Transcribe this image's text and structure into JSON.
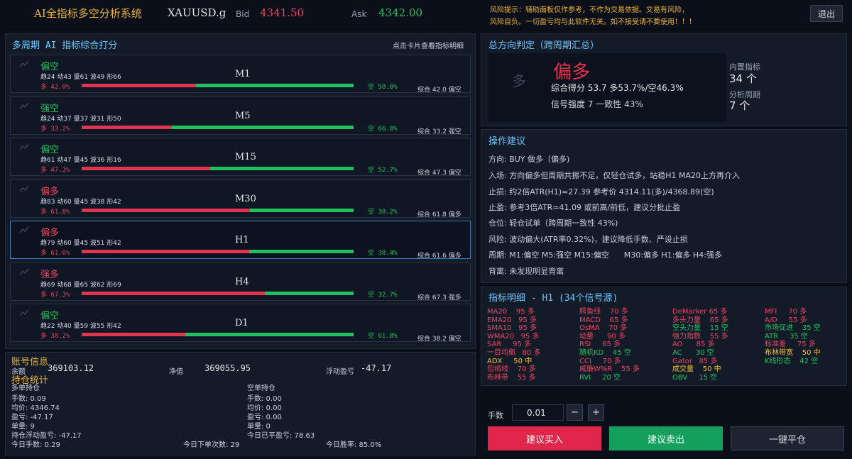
{
  "header": {
    "title": "AI全指标多空分析系统",
    "symbol": "XAUUSD.g",
    "bid_label": "Bid",
    "bid": "4341.50",
    "ask_label": "Ask",
    "ask": "4342.00",
    "risk_line1": "风险提示：辅助面板仅作参考，不作为交易依据。交易有风险，",
    "risk_line2": "风险自负。一切盈亏均与此软件无关。如不接受请不要使用！！！",
    "logout": "退出"
  },
  "multi_period": {
    "title": "多周期 AI 指标综合打分",
    "hint": "点击卡片查看指标明细",
    "cards": [
      {
        "signal": "偏空",
        "tone": "short",
        "stats": "趋24 动43 量61 波49 形66",
        "period": "M1",
        "long": "多 42.0%",
        "long_pct": 42.0,
        "short": "空 58.0%",
        "total": "综合 42.0 偏空",
        "active": false
      },
      {
        "signal": "强空",
        "tone": "short",
        "stats": "趋24 动37 量37 波31 形50",
        "period": "M5",
        "long": "多 33.2%",
        "long_pct": 33.2,
        "short": "空 66.8%",
        "total": "综合 33.2 强空",
        "active": false
      },
      {
        "signal": "偏空",
        "tone": "short",
        "stats": "趋61 动47 量45 波36 形16",
        "period": "M15",
        "long": "多 47.3%",
        "long_pct": 47.3,
        "short": "空 52.7%",
        "total": "综合 47.3 偏空",
        "active": false
      },
      {
        "signal": "偏多",
        "tone": "long",
        "stats": "趋83 动60 量45 波38 形42",
        "period": "M30",
        "long": "多 61.8%",
        "long_pct": 61.8,
        "short": "空 38.2%",
        "total": "综合 61.8 偏多",
        "active": false
      },
      {
        "signal": "偏多",
        "tone": "long",
        "stats": "趋79 动60 量45 波51 形42",
        "period": "H1",
        "long": "多 61.6%",
        "long_pct": 61.6,
        "short": "空 38.4%",
        "total": "综合 61.6 偏多",
        "active": true
      },
      {
        "signal": "强多",
        "tone": "long",
        "stats": "趋69 动68 量65 波62 形69",
        "period": "H4",
        "long": "多 67.3%",
        "long_pct": 67.3,
        "short": "空 32.7%",
        "total": "综合 67.3 强多",
        "active": false
      },
      {
        "signal": "偏空",
        "tone": "short",
        "stats": "趋22 动40 量59 波55 形42",
        "period": "D1",
        "long": "多 38.2%",
        "long_pct": 38.2,
        "short": "空 61.8%",
        "total": "综合 38.2 偏空",
        "active": false
      }
    ]
  },
  "account": {
    "title": "账号信息",
    "balance_label": "余额",
    "balance": "369103.12",
    "equity_label": "净值",
    "equity": "369055.95",
    "floating_label": "浮动盈亏",
    "floating": "-47.17",
    "positions_title": "持仓统计",
    "long_title": "多单持仓",
    "long_lots": "手数: 0.09",
    "long_avg": "均价: 4346.74",
    "long_pl": "盈亏: -47.17",
    "long_count": "单量: 9",
    "total_floating": "持仓浮动盈亏: -47.17",
    "short_title": "空单持仓",
    "short_lots": "手数: 0.00",
    "short_avg": "均价: 0.00",
    "short_pl": "盈亏: 0.00",
    "short_count": "单量: 0",
    "today_closed": "今日已平盈亏: 78.63",
    "today_lots": "今日手数: 0.29",
    "today_orders": "今日下单次数: 29",
    "today_winrate": "今日胜率: 85.0%"
  },
  "direction": {
    "title": "总方向判定（跨周期汇总）",
    "faded": "多",
    "main": "偏多",
    "score": "综合得分 53.7   多53.7%/空46.3%",
    "strength": "信号强度 7  一致性 43%",
    "builtin_label": "内置指标",
    "builtin_value": "34 个",
    "period_label": "分析周期",
    "period_value": "7 个"
  },
  "advice": {
    "title": "操作建议",
    "direction": "方向: BUY 做多（偏多)",
    "entry": "入场: 方向偏多但周期共振不足，仅轻仓试多，站稳H1 MA20上方再介入",
    "stop": "止损: 约2倍ATR(H1)≈27.39  参考价 4314.11(多)/4368.89(空)",
    "take": "止盈: 参考3倍ATR≈41.09 或前高/前低，建议分批止盈",
    "position": "仓位: 轻仓试单（跨周期一致性 43%)",
    "risk": "风险: 波动偏大(ATR率0.32%)，建议降低手数、严设止损",
    "periods": "周期: M1:偏空 M5:强空 M15:偏空      M30:偏多 H1:偏多 H4:强多",
    "divergence": "背离: 未发现明显背离"
  },
  "indicators": {
    "title": "指标明细 - H1 (34个信号源)",
    "columns": [
      [
        {
          "text": "MA20    95 多",
          "c": "red"
        },
        {
          "text": "EMA20   95 多",
          "c": "red"
        },
        {
          "text": "SMA10   95 多",
          "c": "red"
        },
        {
          "text": "WMA20   95 多",
          "c": "red"
        },
        {
          "text": "SAR     95 多",
          "c": "red"
        },
        {
          "text": "一目均衡   80 多",
          "c": "red"
        },
        {
          "text": "ADX     50 中",
          "c": "yellow"
        },
        {
          "text": "包络线    70 多",
          "c": "red"
        },
        {
          "text": "布林带    55 多",
          "c": "red"
        }
      ],
      [
        {
          "text": "鳄鱼线    70 多",
          "c": "red"
        },
        {
          "text": "MACD    65 多",
          "c": "red"
        },
        {
          "text": "OsMA    70 多",
          "c": "red"
        },
        {
          "text": "动量      90 多",
          "c": "red"
        },
        {
          "text": "RSI     65 多",
          "c": "red"
        },
        {
          "text": "随机KD    45 空",
          "c": "green"
        },
        {
          "text": "CCI     70 多",
          "c": "red"
        },
        {
          "text": "威廉W%R    55 多",
          "c": "red"
        },
        {
          "text": "RVI     20 空",
          "c": "green"
        }
      ],
      [
        {
          "text": "DeMarker 65 多",
          "c": "red"
        },
        {
          "text": "多头力量    65 多",
          "c": "red"
        },
        {
          "text": "空头力量    15 空",
          "c": "green"
        },
        {
          "text": "强力指数    55 多",
          "c": "red"
        },
        {
          "text": "AO      85 多",
          "c": "red"
        },
        {
          "text": "AC      30 空",
          "c": "green"
        },
        {
          "text": "Gator   85 多",
          "c": "red"
        },
        {
          "text": "成交量    50 中",
          "c": "yellow"
        },
        {
          "text": "OBV     15 空",
          "c": "green"
        }
      ],
      [
        {
          "text": "MFI     70 多",
          "c": "red"
        },
        {
          "text": "A/D     55 多",
          "c": "red"
        },
        {
          "text": "市场促进    35 空",
          "c": "green"
        },
        {
          "text": "ATR     35 空",
          "c": "green"
        },
        {
          "text": "标准差     75 多",
          "c": "red"
        },
        {
          "text": "布林带宽    50 中",
          "c": "yellow"
        },
        {
          "text": "K线形态    42 空",
          "c": "green"
        }
      ]
    ]
  },
  "trade": {
    "lot_label": "手数",
    "lot_value": "0.01",
    "minus": "−",
    "plus": "+",
    "buy": "建议买入",
    "sell": "建议卖出",
    "close_all": "一键平仓"
  },
  "colors": {
    "long": "#f0435f",
    "short": "#21c25e",
    "accent": "#6cc7ff",
    "title": "#e8b33a"
  }
}
